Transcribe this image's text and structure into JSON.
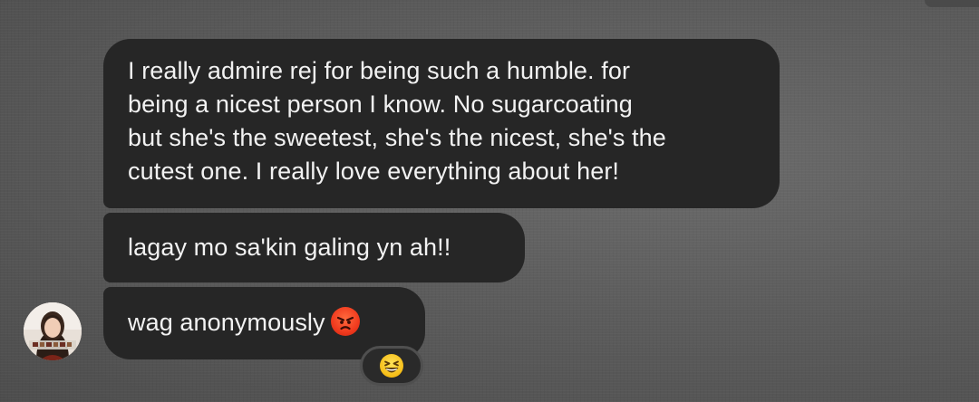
{
  "conversation": {
    "messages": [
      {
        "lines": [
          "I really admire rej for being such a humble. for",
          "being a nicest person I know. No sugarcoating",
          "but she's the sweetest, she's the nicest, she's the",
          "cutest one. I really love everything about her!"
        ]
      },
      {
        "text": "lagay mo sa'kin galing yn ah!!"
      },
      {
        "text": "wag anonymously",
        "emoji": "angry-face-icon"
      }
    ],
    "reaction": {
      "emoji": "grinning-squinting-face-icon"
    },
    "sender": {
      "avatar": "sender-avatar"
    }
  },
  "colors": {
    "background": "#5f5f5f",
    "bubble": "#262626",
    "text": "#f2f2f2"
  }
}
